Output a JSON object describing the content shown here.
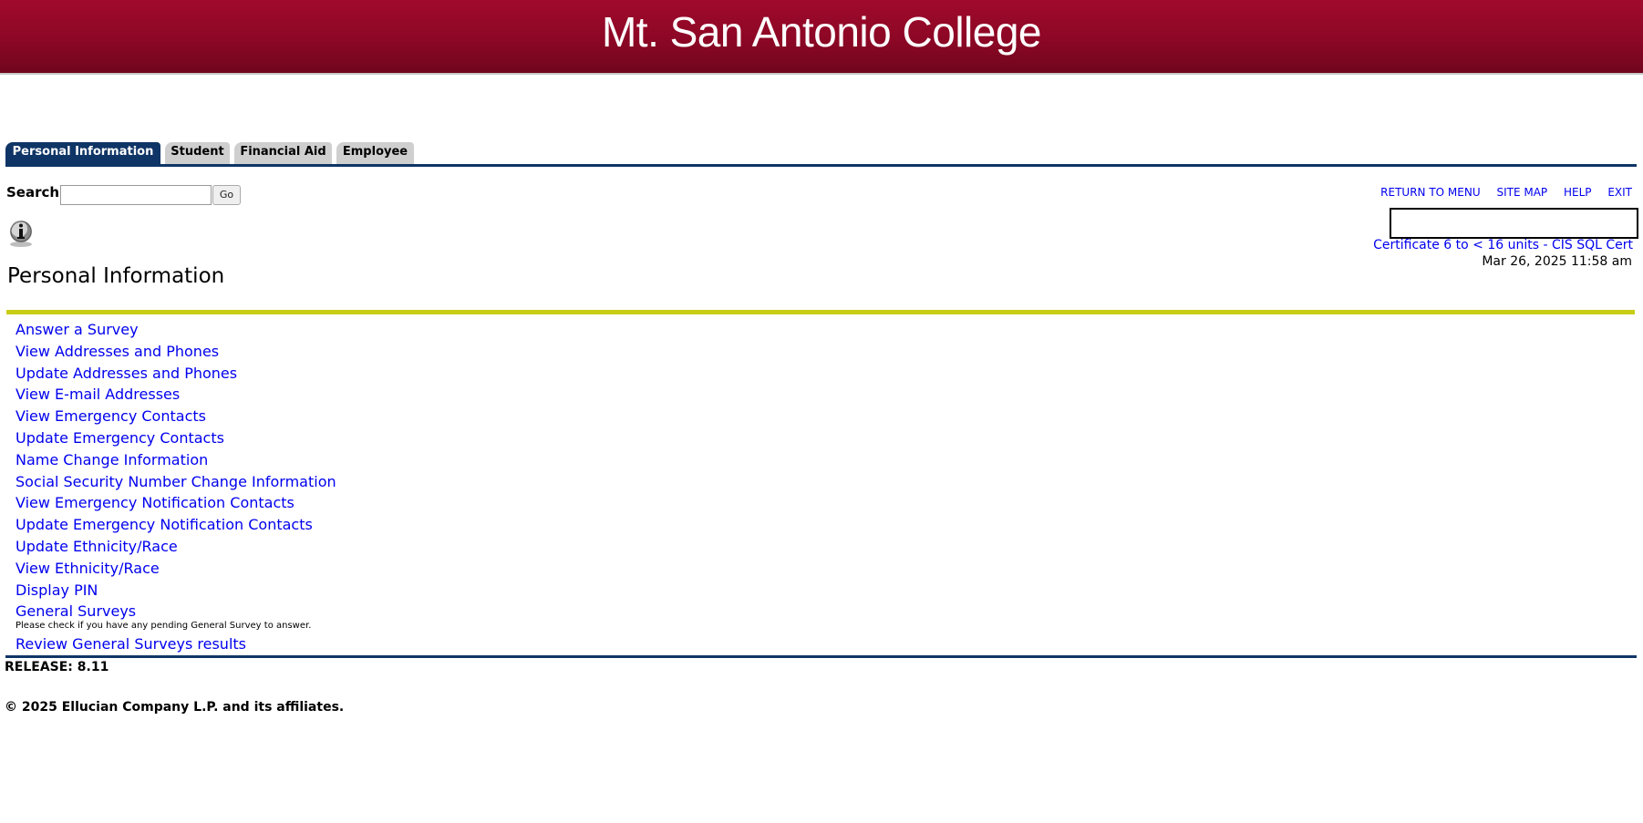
{
  "banner": {
    "title": "Mt. San Antonio College"
  },
  "tabs": [
    {
      "label": "Personal Information",
      "active": true
    },
    {
      "label": "Student",
      "active": false
    },
    {
      "label": "Financial Aid",
      "active": false
    },
    {
      "label": "Employee",
      "active": false
    }
  ],
  "search": {
    "label": "Search",
    "value": "",
    "button": "Go"
  },
  "top_links": [
    "RETURN TO MENU",
    "SITE MAP",
    "HELP",
    "EXIT"
  ],
  "info_icon": "info-icon",
  "header_right": {
    "link": "Certificate 6 to < 16 units - CIS SQL Cert",
    "datetime": "Mar 26, 2025 11:58 am"
  },
  "page_title": "Personal Information",
  "menu": [
    {
      "label": "Answer a Survey"
    },
    {
      "label": "View Addresses and Phones"
    },
    {
      "label": "Update Addresses and Phones"
    },
    {
      "label": "View E-mail Addresses"
    },
    {
      "label": "View Emergency Contacts"
    },
    {
      "label": "Update Emergency Contacts"
    },
    {
      "label": "Name Change Information"
    },
    {
      "label": "Social Security Number Change Information"
    },
    {
      "label": "View Emergency Notification Contacts"
    },
    {
      "label": "Update Emergency Notification Contacts"
    },
    {
      "label": "Update Ethnicity/Race"
    },
    {
      "label": "View Ethnicity/Race"
    },
    {
      "label": "Display PIN"
    },
    {
      "label": "General Surveys",
      "description": "Please check if you have any pending General Survey to answer."
    },
    {
      "label": "Review General Surveys results"
    }
  ],
  "footer": {
    "release": "RELEASE: 8.11",
    "copyright": "© 2025 Ellucian Company L.P. and its affiliates."
  },
  "colors": {
    "banner": "#8c0725",
    "tab_active": "#0f3566",
    "tab_inactive": "#cfcfcf",
    "accent_bar": "#c8cd16",
    "link": "#0000ee"
  }
}
